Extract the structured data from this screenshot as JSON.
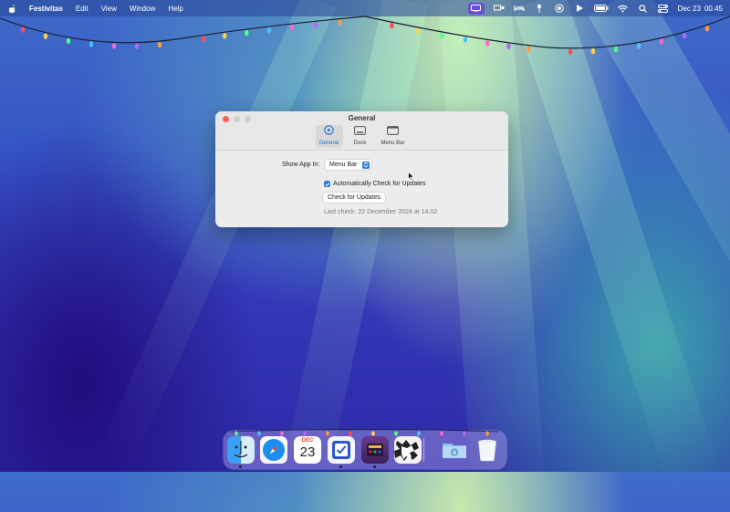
{
  "menubar": {
    "app_name": "Festivitas",
    "menus": [
      "Edit",
      "View",
      "Window",
      "Help"
    ],
    "date": "Dec 23",
    "time": "00.45",
    "status_icons": [
      "festivitas-icon",
      "display-icon",
      "bed-icon",
      "pin-icon",
      "record-icon",
      "play-icon",
      "battery-icon",
      "wifi-icon",
      "search-icon",
      "control-center-icon"
    ]
  },
  "window": {
    "title": "General",
    "tabs": [
      {
        "label": "General",
        "selected": true
      },
      {
        "label": "Dock",
        "selected": false
      },
      {
        "label": "Menu Bar",
        "selected": false
      }
    ],
    "show_app_label": "Show App In:",
    "show_app_value": "Menu Bar",
    "auto_check_label": "Automatically Check for Updates",
    "auto_check_checked": true,
    "check_button": "Check for Updates",
    "last_check": "Last check: 22 December 2024 at 14.02"
  },
  "dock": {
    "apps": [
      "Finder",
      "Safari",
      "Calendar",
      "Reminders",
      "Festivitas",
      "Puzzle",
      "Downloads",
      "Trash"
    ],
    "calendar_month": "DEC",
    "calendar_day": "23"
  },
  "colors": {
    "accent": "#2f7be3",
    "selected_tab_text": "#1f6fd1",
    "menubar_active": "#6a4fd6"
  }
}
